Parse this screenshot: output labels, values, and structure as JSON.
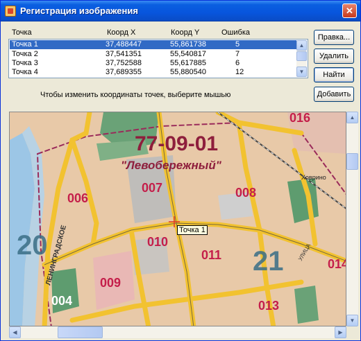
{
  "window": {
    "title": "Регистрация изображения",
    "close_glyph": "✕"
  },
  "list": {
    "columns": [
      "Точка",
      "Коорд X",
      "Коорд Y",
      "Ошибка"
    ],
    "rows": [
      {
        "name": "Точка 1",
        "x": "37,488447",
        "y": "55,861738",
        "err": "5",
        "selected": true
      },
      {
        "name": "Точка 2",
        "x": "37,541351",
        "y": "55,540817",
        "err": "7",
        "selected": false
      },
      {
        "name": "Точка 3",
        "x": "37,752588",
        "y": "55,617885",
        "err": "6",
        "selected": false
      },
      {
        "name": "Точка 4",
        "x": "37,689355",
        "y": "55,880540",
        "err": "12",
        "selected": false
      }
    ]
  },
  "buttons": {
    "edit": "Правка...",
    "delete": "Удалить",
    "find": "Найти",
    "add": "Добавить"
  },
  "hint": "Чтобы изменить координаты точек, выберите мышью",
  "map": {
    "district_code": "77-09-01",
    "district_name": "\"Левобережный\"",
    "areas": [
      "006",
      "007",
      "008",
      "009",
      "010",
      "011",
      "013",
      "004",
      "016",
      "014"
    ],
    "big_numbers": [
      "20",
      "21"
    ],
    "road_labels": [
      "ЛЕНИНГРАДСКОЕ",
      "Ховрино",
      "УЛИЦА"
    ],
    "marker_label": "Точка 1"
  }
}
